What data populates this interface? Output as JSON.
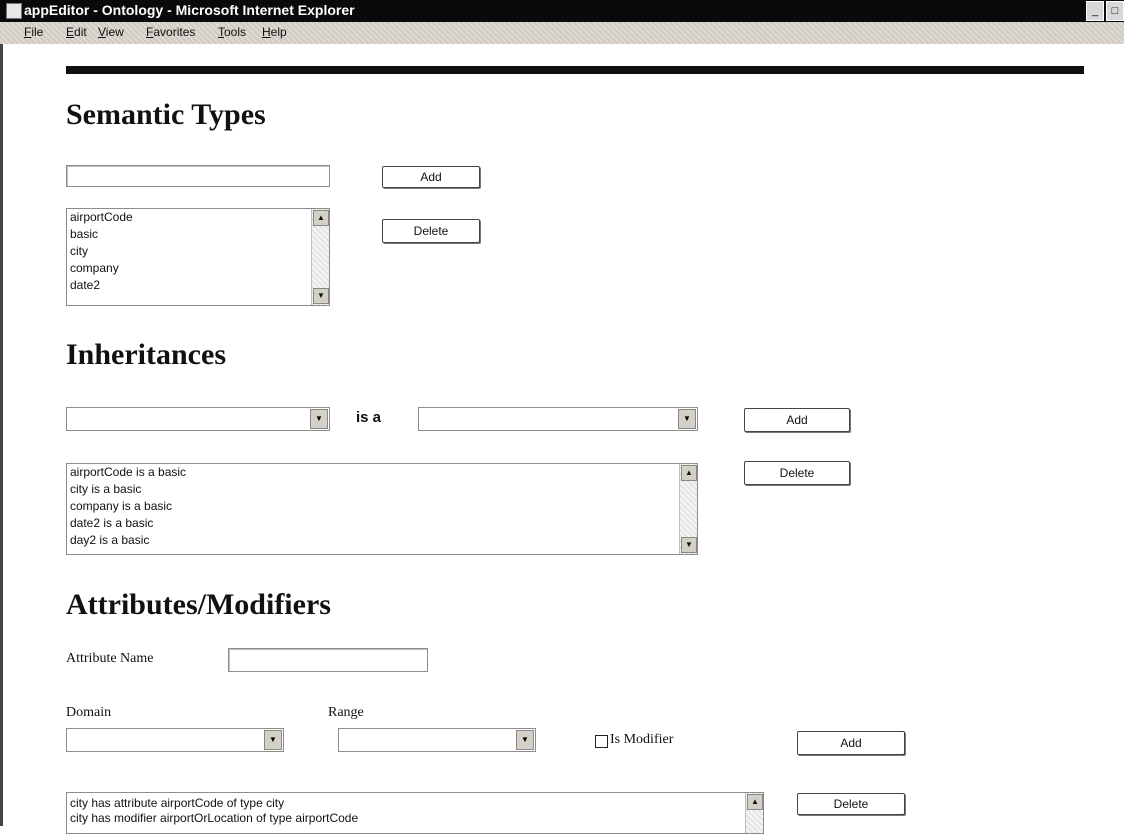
{
  "window": {
    "title": "appEditor - Ontology - Microsoft Internet Explorer"
  },
  "menu": [
    "File",
    "Edit",
    "View",
    "Favorites",
    "Tools",
    "Help"
  ],
  "semantic_types": {
    "heading": "Semantic Types",
    "input_value": "",
    "add_label": "Add",
    "delete_label": "Delete",
    "items": [
      "airportCode",
      "basic",
      "city",
      "company",
      "date2"
    ]
  },
  "inheritances": {
    "heading": "Inheritances",
    "is_a_label": "is a",
    "left_selected": "",
    "right_selected": "",
    "add_label": "Add",
    "delete_label": "Delete",
    "items": [
      "airportCode is a basic",
      "city is a basic",
      "company is a basic",
      "date2 is a basic",
      "day2 is a basic"
    ]
  },
  "attributes": {
    "heading": "Attributes/Modifiers",
    "attribute_name_label": "Attribute Name",
    "attribute_name_value": "",
    "domain_label": "Domain",
    "range_label": "Range",
    "domain_selected": "",
    "range_selected": "",
    "is_modifier_label": "Is Modifier",
    "add_label": "Add",
    "delete_label": "Delete",
    "items": [
      "city has attribute airportCode of type city",
      "city has modifier airportOrLocation of type airportCode"
    ]
  }
}
